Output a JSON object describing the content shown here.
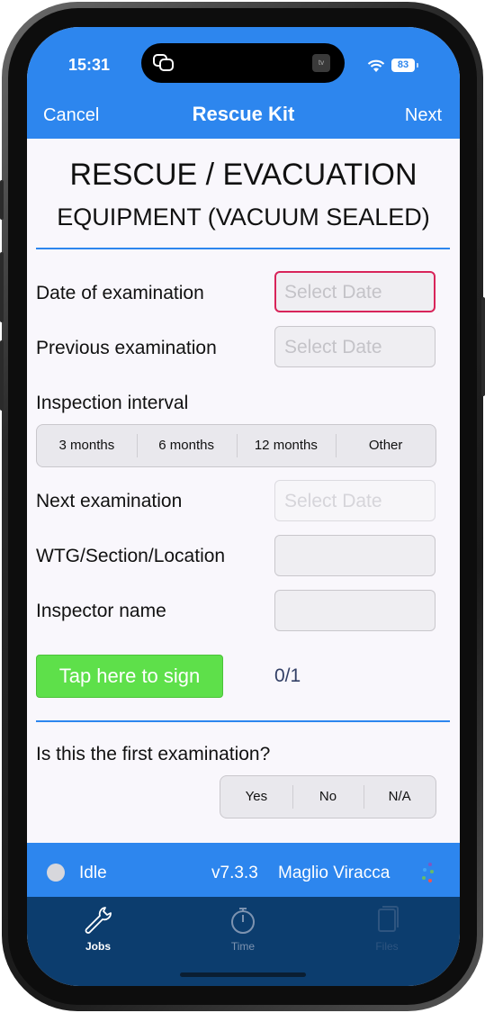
{
  "status": {
    "time": "15:31",
    "battery": "83"
  },
  "nav": {
    "cancel": "Cancel",
    "title": "Rescue Kit",
    "next": "Next"
  },
  "form": {
    "title_line1": "RESCUE / EVACUATION",
    "title_line2": "EQUIPMENT (VACUUM SEALED)",
    "date_of_exam_label": "Date of examination",
    "date_of_exam_placeholder": "Select Date",
    "previous_exam_label": "Previous examination",
    "previous_exam_placeholder": "Select Date",
    "interval_label": "Inspection interval",
    "interval_options": [
      "3 months",
      "6 months",
      "12 months",
      "Other"
    ],
    "next_exam_label": "Next examination",
    "next_exam_placeholder": "Select Date",
    "location_label": "WTG/Section/Location",
    "location_value": "",
    "inspector_label": "Inspector name",
    "inspector_value": "",
    "sign_button": "Tap here to sign",
    "sign_count": "0/1",
    "first_exam_label": "Is this the first examination?",
    "first_exam_options": [
      "Yes",
      "No",
      "N/A"
    ]
  },
  "footer": {
    "status": "Idle",
    "version": "v7.3.3",
    "user": "Maglio Viracca"
  },
  "tabs": [
    {
      "label": "Jobs",
      "icon": "wrench-icon",
      "state": "active"
    },
    {
      "label": "Time",
      "icon": "stopwatch-icon",
      "state": "inactive"
    },
    {
      "label": "Files",
      "icon": "documents-icon",
      "state": "disabled"
    }
  ],
  "colors": {
    "accent": "#2d86ee",
    "tabbar": "#0c3d6e",
    "sign": "#5ee04a",
    "error": "#d8245a"
  }
}
